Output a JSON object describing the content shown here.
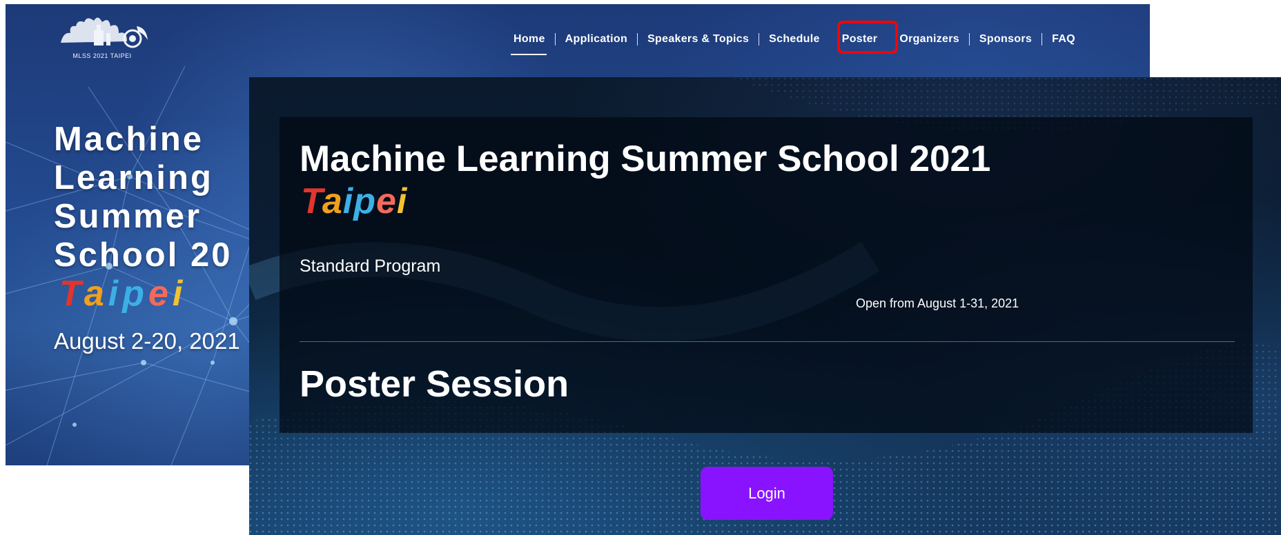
{
  "back_page": {
    "logo": {
      "icon": "mlss-taipei-logo",
      "text": "MLSS 2021 TAIPEI"
    },
    "nav": [
      {
        "label": "Home",
        "active": true
      },
      {
        "label": "Application"
      },
      {
        "label": "Speakers & Topics"
      },
      {
        "label": "Schedule"
      },
      {
        "label": "Poster",
        "highlighted": true
      },
      {
        "label": "Organizers"
      },
      {
        "label": "Sponsors"
      },
      {
        "label": "FAQ"
      }
    ],
    "hero_title": "Machine\nLearning\nSummer\nSchool 20",
    "hero_taipei": [
      "T",
      "a",
      "i",
      "p",
      "e",
      "i"
    ],
    "hero_dates": "August 2-20, 2021",
    "highlight_color": "#ff0000"
  },
  "front_page": {
    "title": "Machine Learning Summer School 2021",
    "taipei": [
      "T",
      "a",
      "i",
      "p",
      "e",
      "i"
    ],
    "program": "Standard Program",
    "open_from": "Open from August 1-31, 2021",
    "section_title": "Poster Session",
    "login_label": "Login",
    "login_color": "#8a13ff"
  }
}
